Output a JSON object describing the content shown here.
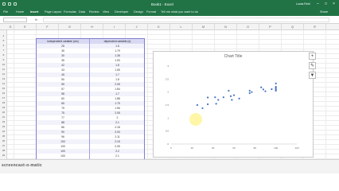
{
  "window": {
    "title": "Book1 - Excel",
    "user": "Lucas Reid",
    "accent": "#217346"
  },
  "ribbon": {
    "tabs": [
      "File",
      "Home",
      "Insert",
      "Page Layout",
      "Formulas",
      "Data",
      "Review",
      "View",
      "Developer",
      "Design",
      "Format"
    ],
    "tell_me": "Tell me what you want to do",
    "share": "Share",
    "active_tab": "Insert"
  },
  "formula_bar": {
    "name_box": "",
    "fx": "fx",
    "value": ""
  },
  "columns": [
    "G",
    "E",
    "F",
    "G",
    "H",
    "I",
    "J",
    "K",
    "L",
    "M",
    "N",
    "O",
    "P",
    "Q",
    "R"
  ],
  "rows": [
    "4",
    "5",
    "6",
    "7",
    "8",
    "9",
    "10",
    "11",
    "12",
    "13",
    "14",
    "15",
    "16",
    "17",
    "18",
    "19",
    "20",
    "21",
    "22",
    "23",
    "24",
    "25",
    "26",
    "27",
    "28",
    "29",
    "30"
  ],
  "table": {
    "headers": [
      "independent variable (cm)",
      "dependent variable (s)"
    ],
    "rows": [
      [
        "25",
        "1.5"
      ],
      [
        "35",
        "1.79"
      ],
      [
        "30",
        "1.38"
      ],
      [
        "35",
        "1.53"
      ],
      [
        "42",
        "1.8"
      ],
      [
        "43",
        "1.55"
      ],
      [
        "45",
        "1.7"
      ],
      [
        "50",
        "1.8"
      ],
      [
        "55",
        "2.05"
      ],
      [
        "57",
        "1.84"
      ],
      [
        "58",
        "1.7"
      ],
      [
        "60",
        "1.88"
      ],
      [
        "65",
        "1.75"
      ],
      [
        "75",
        "1.96"
      ],
      [
        "75",
        "2.05"
      ],
      [
        "77",
        "2"
      ],
      [
        "88",
        "2.1"
      ],
      [
        "86",
        "2.18"
      ],
      [
        "90",
        "2.03"
      ],
      [
        "96",
        "2.11"
      ],
      [
        "100",
        "2.15"
      ],
      [
        "100",
        "2.05"
      ],
      [
        "100",
        "2.2"
      ],
      [
        "100",
        "2.1"
      ],
      [
        "100",
        "2.33"
      ]
    ]
  },
  "chart": {
    "title": "Chart Title",
    "tools": [
      "+",
      "✎",
      "▼"
    ]
  },
  "chart_data": {
    "type": "scatter",
    "title": "Chart Title",
    "x": [
      25,
      35,
      30,
      35,
      42,
      43,
      45,
      50,
      55,
      57,
      58,
      60,
      65,
      75,
      75,
      77,
      88,
      86,
      90,
      96,
      100,
      100,
      100,
      100,
      100
    ],
    "y": [
      1.5,
      1.79,
      1.38,
      1.53,
      1.8,
      1.55,
      1.7,
      1.8,
      2.05,
      1.84,
      1.7,
      1.88,
      1.75,
      1.96,
      2.05,
      2,
      2.1,
      2.18,
      2.03,
      2.11,
      2.15,
      2.05,
      2.2,
      2.1,
      2.33
    ],
    "xlim": [
      0,
      120
    ],
    "ylim": [
      0,
      3
    ],
    "xticks": [
      "0",
      "20",
      "40",
      "60",
      "80",
      "100",
      "120"
    ],
    "yticks": [
      "0",
      "0.5",
      "1",
      "1.5",
      "2",
      "2.5",
      "3"
    ],
    "xlabel": "",
    "ylabel": "",
    "color": "#4472c4",
    "grid": false
  },
  "watermark": "screencast-o-matic"
}
